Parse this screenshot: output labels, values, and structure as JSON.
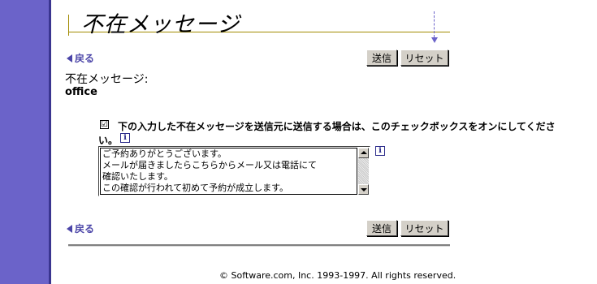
{
  "header": {
    "title": "不在メッセージ"
  },
  "nav": {
    "back_top": "戻る",
    "back_bottom": "戻る"
  },
  "toolbar_top": {
    "send_label": "送信",
    "reset_label": "リセット"
  },
  "toolbar_bottom": {
    "send_label": "送信",
    "reset_label": "リセット"
  },
  "form": {
    "heading": "不在メッセージ:",
    "account": "office",
    "checkbox_checked": true,
    "checkbox_mark": "☑",
    "checkbox_label_line1": "下の入力した不在メッセージを送信元に送信する場合は、このチェックボックスをオンにしてくださ",
    "checkbox_label_line2": "い。",
    "message_lines": [
      "ご予約ありがとうございます。",
      "メールが届きましたらこちらからメール又は電話にて",
      "確認いたします。",
      "この確認が行われて初めて予約が成立します。"
    ]
  },
  "icons": {
    "info": "i"
  },
  "footer": {
    "copyright": "© Software.com, Inc. 1993-1997. All rights reserved."
  },
  "colors": {
    "sidebar": "#6b63c9",
    "link": "#4b45a8",
    "title_rule": "#a08a00"
  }
}
